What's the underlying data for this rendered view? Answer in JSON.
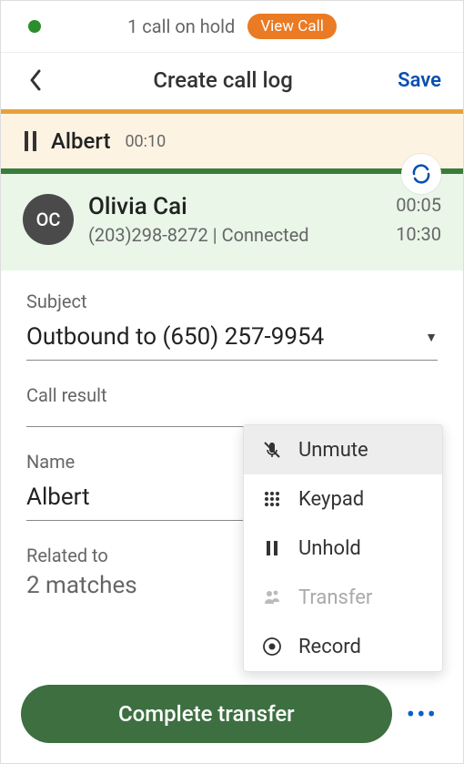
{
  "banner": {
    "text": "1 call on hold",
    "button": "View Call"
  },
  "header": {
    "title": "Create call log",
    "save": "Save"
  },
  "hold": {
    "name": "Albert",
    "duration": "00:10"
  },
  "caller": {
    "initials": "OC",
    "name": "Olivia Cai",
    "phone": "(203)298-8272",
    "status": "Connected",
    "duration": "00:05",
    "clock": "10:30"
  },
  "form": {
    "subject_label": "Subject",
    "subject_value": "Outbound to (650) 257-9954",
    "call_result_label": "Call result",
    "call_result_value": "",
    "name_label": "Name",
    "name_value": "Albert",
    "related_label": "Related to",
    "related_value": "2 matches"
  },
  "footer": {
    "complete": "Complete transfer"
  },
  "menu": {
    "unmute": "Unmute",
    "keypad": "Keypad",
    "unhold": "Unhold",
    "transfer": "Transfer",
    "record": "Record"
  }
}
